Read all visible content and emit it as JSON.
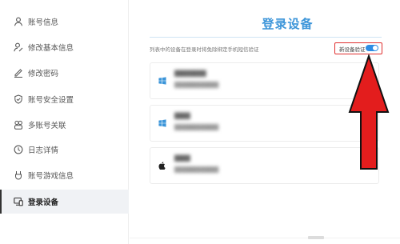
{
  "sidebar": {
    "items": [
      {
        "label": "账号信息",
        "icon": "user-icon",
        "active": false
      },
      {
        "label": "修改基本信息",
        "icon": "user-edit-icon",
        "active": false
      },
      {
        "label": "修改密码",
        "icon": "pencil-icon",
        "active": false
      },
      {
        "label": "账号安全设置",
        "icon": "shield-check-icon",
        "active": false
      },
      {
        "label": "多账号关联",
        "icon": "multi-account-icon",
        "active": false
      },
      {
        "label": "日志详情",
        "icon": "clock-icon",
        "active": false
      },
      {
        "label": "账号游戏信息",
        "icon": "gamepad-icon",
        "active": false
      },
      {
        "label": "登录设备",
        "icon": "devices-icon",
        "active": true
      }
    ]
  },
  "main": {
    "title": "登录设备",
    "description": "列表中的设备在登录时将免除绑定手机短信验证",
    "verify": {
      "label": "新设备验证",
      "enabled": true
    },
    "devices": [
      {
        "icon": "windows-icon",
        "name": "████████",
        "time": "████████████"
      },
      {
        "icon": "windows-icon",
        "name": "████",
        "time": "████████████"
      },
      {
        "icon": "apple-icon",
        "name": "████",
        "time": "████████████"
      }
    ]
  },
  "colors": {
    "accent": "#3c95d9",
    "toggle": "#2f8de4",
    "annotation": "#e31d1d"
  }
}
